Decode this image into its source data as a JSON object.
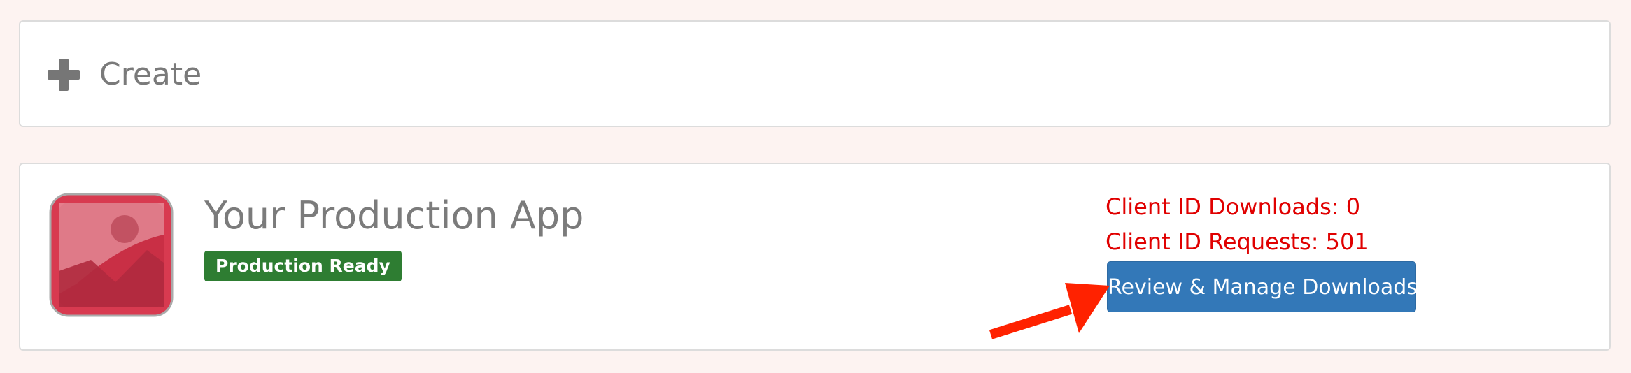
{
  "create": {
    "icon": "plus-icon",
    "label": "Create"
  },
  "app": {
    "icon": "image-icon",
    "title": "Your Production App",
    "status_badge": "Production Ready",
    "downloads_text": "Client ID Downloads: 0",
    "requests_text": "Client ID Requests: 501",
    "manage_button": "Review & Manage Downloads"
  },
  "colors": {
    "background": "#fdf3f1",
    "badge": "#2e7d32",
    "stats_text": "#e00000",
    "button": "#3378b8",
    "arrow": "#ff2200",
    "app_icon": "#d83a50"
  }
}
